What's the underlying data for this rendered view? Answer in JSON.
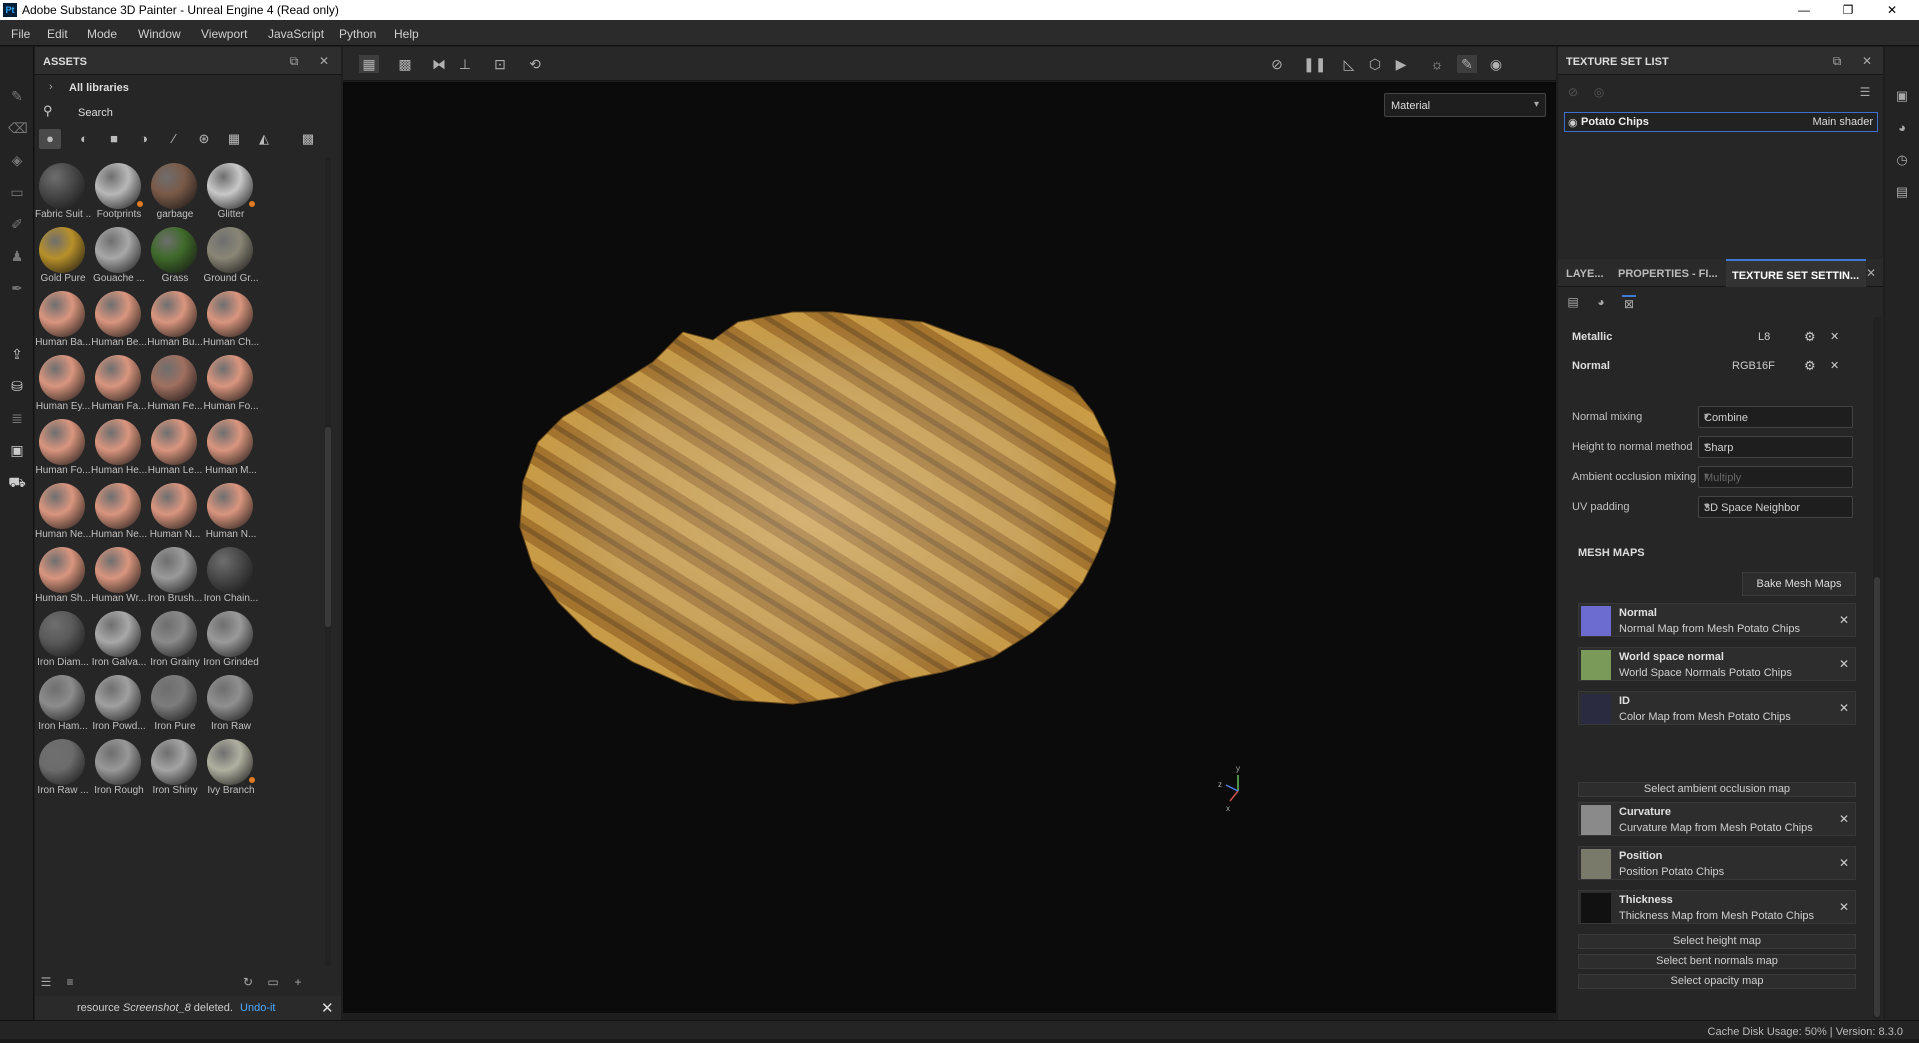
{
  "window": {
    "title": "Adobe Substance 3D Painter - Unreal Engine 4 (Read only)",
    "app_icon": "Pt",
    "controls": [
      "—",
      "❐",
      "✕"
    ]
  },
  "menu": [
    "File",
    "Edit",
    "Mode",
    "Window",
    "Viewport",
    "JavaScript",
    "Python",
    "Help"
  ],
  "assets": {
    "title": "ASSETS",
    "library": "All libraries",
    "search_placeholder": "Search",
    "items": [
      {
        "label": "Fabric Suit ...",
        "color": "#4a4a4a",
        "dot": false
      },
      {
        "label": "Footprints",
        "color": "#b8b8b8",
        "dot": true
      },
      {
        "label": "garbage",
        "color": "#7a5a48",
        "dot": false
      },
      {
        "label": "Glitter",
        "color": "#c8c8c8",
        "dot": true
      },
      {
        "label": "Gold Pure",
        "color": "#b8902a",
        "dot": false
      },
      {
        "label": "Gouache ...",
        "color": "#a8a8a8",
        "dot": false
      },
      {
        "label": "Grass",
        "color": "#3f6a2a",
        "dot": false
      },
      {
        "label": "Ground Gr...",
        "color": "#8a8676",
        "dot": false
      },
      {
        "label": "Human Ba...",
        "color": "#d9957e",
        "dot": false
      },
      {
        "label": "Human Be...",
        "color": "#d9957e",
        "dot": false
      },
      {
        "label": "Human Bu...",
        "color": "#d9957e",
        "dot": false
      },
      {
        "label": "Human Ch...",
        "color": "#d9957e",
        "dot": false
      },
      {
        "label": "Human Ey...",
        "color": "#d9957e",
        "dot": false
      },
      {
        "label": "Human Fa...",
        "color": "#d9957e",
        "dot": false
      },
      {
        "label": "Human Fe...",
        "color": "#a07060",
        "dot": false
      },
      {
        "label": "Human Fo...",
        "color": "#d9957e",
        "dot": false
      },
      {
        "label": "Human Fo...",
        "color": "#d9957e",
        "dot": false
      },
      {
        "label": "Human He...",
        "color": "#d9957e",
        "dot": false
      },
      {
        "label": "Human Le...",
        "color": "#d9957e",
        "dot": false
      },
      {
        "label": "Human M...",
        "color": "#d9957e",
        "dot": false
      },
      {
        "label": "Human Ne...",
        "color": "#d9957e",
        "dot": false
      },
      {
        "label": "Human Ne...",
        "color": "#d9957e",
        "dot": false
      },
      {
        "label": "Human N...",
        "color": "#d9957e",
        "dot": false
      },
      {
        "label": "Human N...",
        "color": "#d9957e",
        "dot": false
      },
      {
        "label": "Human Sh...",
        "color": "#d9957e",
        "dot": false
      },
      {
        "label": "Human Wr...",
        "color": "#d9957e",
        "dot": false
      },
      {
        "label": "Iron Brush...",
        "color": "#9a9a9a",
        "dot": false
      },
      {
        "label": "Iron Chain...",
        "color": "#4a4a4a",
        "dot": false
      },
      {
        "label": "Iron Diam...",
        "color": "#5a5a5a",
        "dot": false
      },
      {
        "label": "Iron Galva...",
        "color": "#a8a8a8",
        "dot": false
      },
      {
        "label": "Iron Grainy",
        "color": "#8a8a8a",
        "dot": false
      },
      {
        "label": "Iron Grinded",
        "color": "#9a9a9a",
        "dot": false
      },
      {
        "label": "Iron Ham...",
        "color": "#8c8c8c",
        "dot": false
      },
      {
        "label": "Iron Powd...",
        "color": "#a0a0a0",
        "dot": false
      },
      {
        "label": "Iron Pure",
        "color": "#7c7c7c",
        "dot": false
      },
      {
        "label": "Iron Raw",
        "color": "#909090",
        "dot": false
      },
      {
        "label": "Iron Raw ...",
        "color": "#6c6c6c",
        "dot": false
      },
      {
        "label": "Iron Rough",
        "color": "#989898",
        "dot": false
      },
      {
        "label": "Iron Shiny",
        "color": "#a4a4a4",
        "dot": false
      },
      {
        "label": "Ivy Branch",
        "color": "#b0b0a0",
        "dot": true
      }
    ],
    "notification": {
      "prefix": "resource ",
      "name": "Screenshot_8",
      "suffix": " deleted.",
      "link": "Undo-it"
    }
  },
  "viewport": {
    "material_mode": "Material"
  },
  "texture_set_list": {
    "title": "TEXTURE SET LIST",
    "set_name": "Potato Chips",
    "shader": "Main shader"
  },
  "tabs": [
    "LAYE...",
    "PROPERTIES - FI...",
    "TEXTURE SET SETTIN..."
  ],
  "channels": [
    {
      "name": "Metallic",
      "format": "L8"
    },
    {
      "name": "Normal",
      "format": "RGB16F"
    }
  ],
  "settings": [
    {
      "label": "Normal mixing",
      "value": "Combine",
      "disabled": false
    },
    {
      "label": "Height to normal method",
      "value": "Sharp",
      "disabled": false
    },
    {
      "label": "Ambient occlusion mixing",
      "value": "Multiply",
      "disabled": true
    },
    {
      "label": "UV padding",
      "value": "3D Space Neighbor",
      "disabled": false
    }
  ],
  "mesh_maps": {
    "title": "MESH MAPS",
    "bake_label": "Bake Mesh Maps",
    "maps": [
      {
        "name": "Normal",
        "desc": "Normal Map from Mesh Potato Chips",
        "color": "#6b6bd0"
      },
      {
        "name": "World space normal",
        "desc": "World Space Normals Potato Chips",
        "color": "#7a9a5a"
      },
      {
        "name": "ID",
        "desc": "Color Map from Mesh Potato Chips",
        "color": "#2a2a40"
      },
      {
        "name": "Curvature",
        "desc": "Curvature Map from Mesh Potato Chips",
        "color": "#8a8a8a"
      },
      {
        "name": "Position",
        "desc": "Position Potato Chips",
        "color": "#7a7a6a"
      },
      {
        "name": "Thickness",
        "desc": "Thickness Map from Mesh Potato Chips",
        "color": "#111111"
      }
    ],
    "select_ao": "Select ambient occlusion map",
    "select_height": "Select height map",
    "select_bent": "Select bent normals map",
    "select_opacity": "Select opacity map"
  },
  "status": "Cache Disk Usage:  50% | Version: 8.3.0"
}
